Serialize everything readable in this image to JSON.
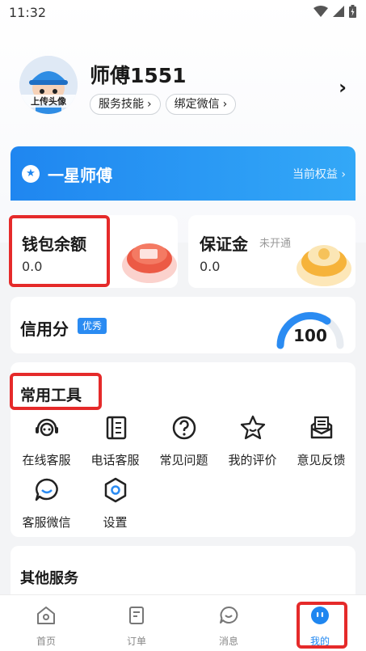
{
  "status_bar": {
    "time": "11:32"
  },
  "profile": {
    "name": "师傅1551",
    "avatar_label": "上传头像",
    "chips": [
      "服务技能",
      "绑定微信"
    ]
  },
  "star_banner": {
    "title": "一星师傅",
    "rights": "当前权益"
  },
  "wallet": {
    "title": "钱包余额",
    "value": "0.0"
  },
  "deposit": {
    "title": "保证金",
    "status": "未开通",
    "value": "0.0"
  },
  "credit": {
    "title": "信用分",
    "badge": "优秀",
    "score": "100"
  },
  "tools": {
    "title": "常用工具",
    "items": [
      {
        "label": "在线客服",
        "icon": "headset-icon"
      },
      {
        "label": "电话客服",
        "icon": "phone-book-icon"
      },
      {
        "label": "常见问题",
        "icon": "question-icon"
      },
      {
        "label": "我的评价",
        "icon": "star-smile-icon"
      },
      {
        "label": "意见反馈",
        "icon": "feedback-icon"
      },
      {
        "label": "客服微信",
        "icon": "chat-smile-icon"
      },
      {
        "label": "设置",
        "icon": "settings-hex-icon"
      }
    ]
  },
  "others": {
    "title": "其他服务"
  },
  "tabbar": {
    "items": [
      {
        "label": "首页",
        "icon": "home-icon"
      },
      {
        "label": "订单",
        "icon": "order-icon"
      },
      {
        "label": "消息",
        "icon": "message-icon"
      },
      {
        "label": "我的",
        "icon": "me-icon"
      }
    ],
    "active": "我的"
  },
  "colors": {
    "accent": "#1f86f0",
    "highlight": "#e52a2a"
  }
}
